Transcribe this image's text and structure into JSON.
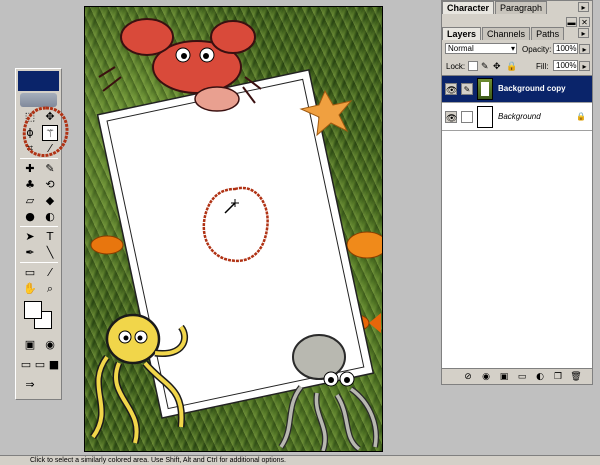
{
  "panel": {
    "top_tabs": [
      "Character",
      "Paragraph"
    ],
    "tabs": [
      "Layers",
      "Channels",
      "Paths"
    ],
    "blend_mode": "Normal",
    "opacity_label": "Opacity:",
    "opacity_value": "100%",
    "lock_label": "Lock:",
    "fill_label": "Fill:",
    "fill_value": "100%",
    "layers": [
      {
        "name": "Background copy",
        "selected": true
      },
      {
        "name": "Background",
        "selected": false,
        "locked": true
      }
    ]
  },
  "status_bar": {
    "text": "Click to select a similarly colored area. Use Shift, Alt and Ctrl for additional options."
  },
  "icons": {
    "active_tool": "magic-wand-icon",
    "annotations_color": "#b03214",
    "selection_color": "#0a246a"
  }
}
